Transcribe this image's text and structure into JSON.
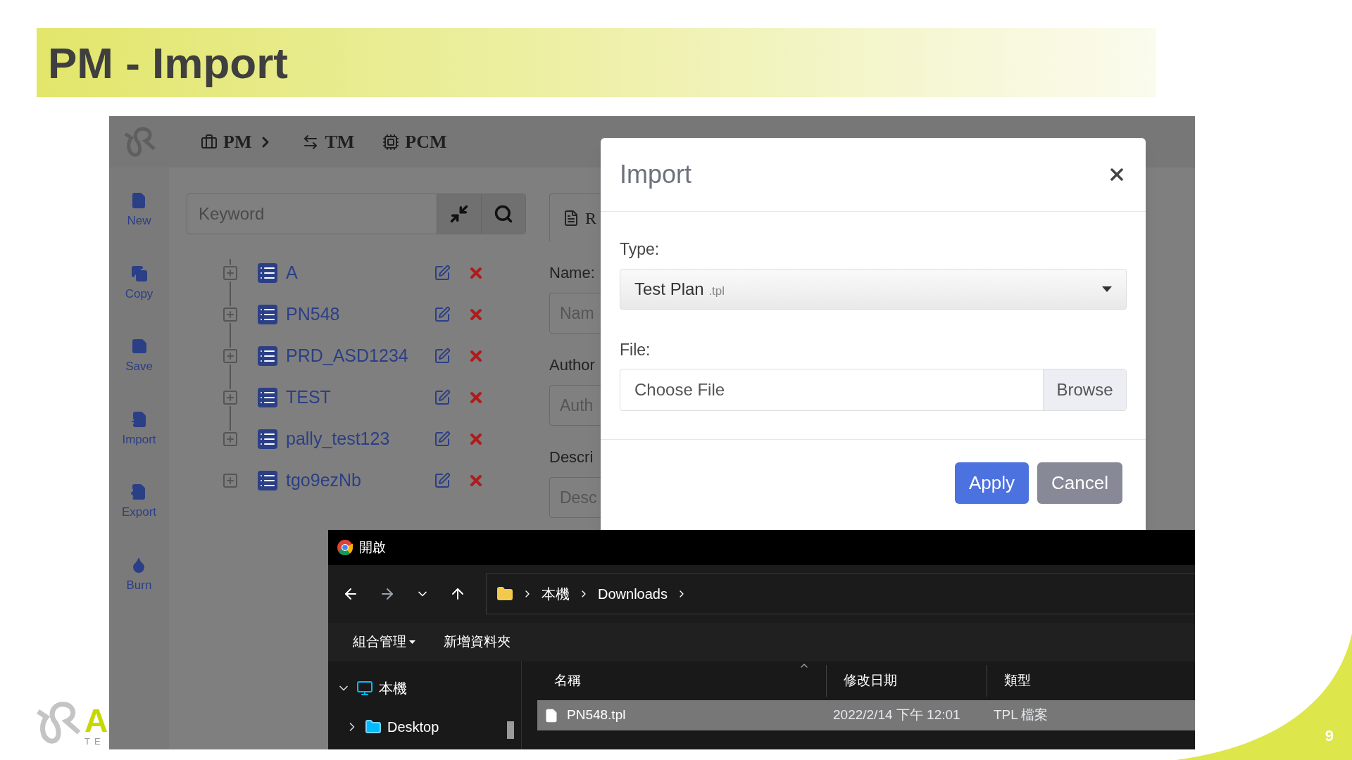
{
  "slide": {
    "title": "PM - Import",
    "page_number": "9",
    "logo_text": [
      "A",
      "TE"
    ]
  },
  "app": {
    "nav": [
      {
        "label": "PM",
        "kind": "pm",
        "has_chevron": true
      },
      {
        "label": "TM",
        "kind": "tm",
        "has_chevron": false
      },
      {
        "label": "PCM",
        "kind": "pcm",
        "has_chevron": false
      }
    ],
    "sidebar": [
      {
        "label": "New",
        "kind": "new"
      },
      {
        "label": "Copy",
        "kind": "copy"
      },
      {
        "label": "Save",
        "kind": "save"
      },
      {
        "label": "Import",
        "kind": "import"
      },
      {
        "label": "Export",
        "kind": "export"
      },
      {
        "label": "Burn",
        "kind": "burn"
      }
    ],
    "search": {
      "placeholder": "Keyword"
    },
    "tree": [
      {
        "label": "A",
        "expanded": false
      },
      {
        "label": "PN548",
        "expanded": false
      },
      {
        "label": "PRD_ASD1234",
        "expanded": false
      },
      {
        "label": "TEST",
        "expanded": false
      },
      {
        "label": "pally_test123",
        "expanded": false
      },
      {
        "label": "tgo9ezNb",
        "expanded": false
      }
    ],
    "detail": {
      "tab_label": "R",
      "fields": [
        {
          "label": "Name:",
          "placeholder": "Nam"
        },
        {
          "label": "Author",
          "placeholder": "Auth"
        },
        {
          "label": "Descri",
          "placeholder": "Desc"
        }
      ]
    }
  },
  "import_modal": {
    "title": "Import",
    "type_label": "Type:",
    "type_value": "Test Plan",
    "type_ext": ".tpl",
    "file_label": "File:",
    "file_placeholder": "Choose File",
    "browse": "Browse",
    "buttons": [
      {
        "label": "Apply",
        "kind": "primary"
      },
      {
        "label": "Cancel",
        "kind": "secondary"
      }
    ]
  },
  "file_dialog": {
    "title": "開啟",
    "path": [
      "本機",
      "Downloads"
    ],
    "toolbar": [
      {
        "label": "組合管理",
        "has_menu": true
      },
      {
        "label": "新增資料夾",
        "has_menu": false
      }
    ],
    "nav_tree": [
      {
        "label": "本機",
        "kind": "pc",
        "expanded": true,
        "children": [
          {
            "label": "Desktop",
            "kind": "desktop",
            "expanded": false
          }
        ]
      }
    ],
    "columns": [
      "名稱",
      "修改日期",
      "類型"
    ],
    "files": [
      {
        "name": "PN548.tpl",
        "modified": "2022/2/14 下午 12:01",
        "type": "TPL 檔案",
        "selected": true
      }
    ]
  }
}
